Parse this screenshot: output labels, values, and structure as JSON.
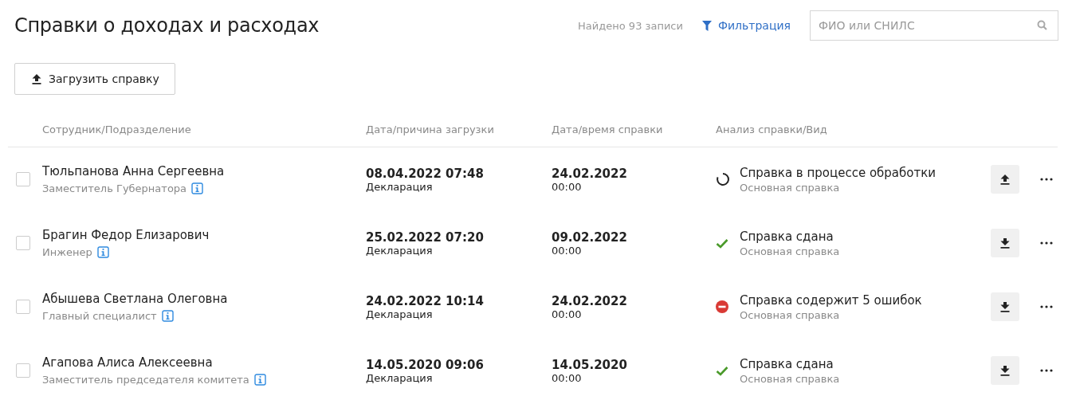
{
  "page_title": "Справки о доходах и расходах",
  "found_count": "Найдено 93 записи",
  "filter_link": "Фильтрация",
  "search": {
    "placeholder": "ФИО или СНИЛС"
  },
  "upload_button": "Загрузить справку",
  "table": {
    "columns": [
      "Сотрудник/Подразделение",
      "Дата/причина загрузки",
      "Дата/время справки",
      "Анализ справки/Вид"
    ],
    "rows": [
      {
        "checked": false,
        "name": "Тюльпанова Анна Сергеевна",
        "position": "Заместитель Губернатора",
        "upload_date": "08.04.2022 07:48",
        "upload_reason": "Декларация",
        "report_date": "24.02.2022",
        "report_time": "00:00",
        "status": {
          "kind": "processing",
          "text": "Справка в процессе обработки"
        },
        "type": "Основная справка",
        "action": {
          "kind": "upload"
        }
      },
      {
        "checked": false,
        "name": "Брагин Федор Елизарович",
        "position": "Инженер",
        "upload_date": "25.02.2022 07:20",
        "upload_reason": "Декларация",
        "report_date": "09.02.2022",
        "report_time": "00:00",
        "status": {
          "kind": "done",
          "text": "Справка сдана"
        },
        "type": "Основная справка",
        "action": {
          "kind": "download"
        }
      },
      {
        "checked": false,
        "name": "Абышева Светлана Олеговна",
        "position": "Главный специалист",
        "upload_date": "24.02.2022 10:14",
        "upload_reason": "Декларация",
        "report_date": "24.02.2022",
        "report_time": "00:00",
        "status": {
          "kind": "error",
          "text": "Справка содержит 5 ошибок"
        },
        "type": "Основная справка",
        "action": {
          "kind": "download"
        }
      },
      {
        "checked": false,
        "name": "Агапова Алиса Алексеевна",
        "position": "Заместитель председателя комитета",
        "upload_date": "14.05.2020 09:06",
        "upload_reason": "Декларация",
        "report_date": "14.05.2020",
        "report_time": "00:00",
        "status": {
          "kind": "done",
          "text": "Справка сдана"
        },
        "type": "Основная справка",
        "action": {
          "kind": "download"
        }
      }
    ]
  }
}
